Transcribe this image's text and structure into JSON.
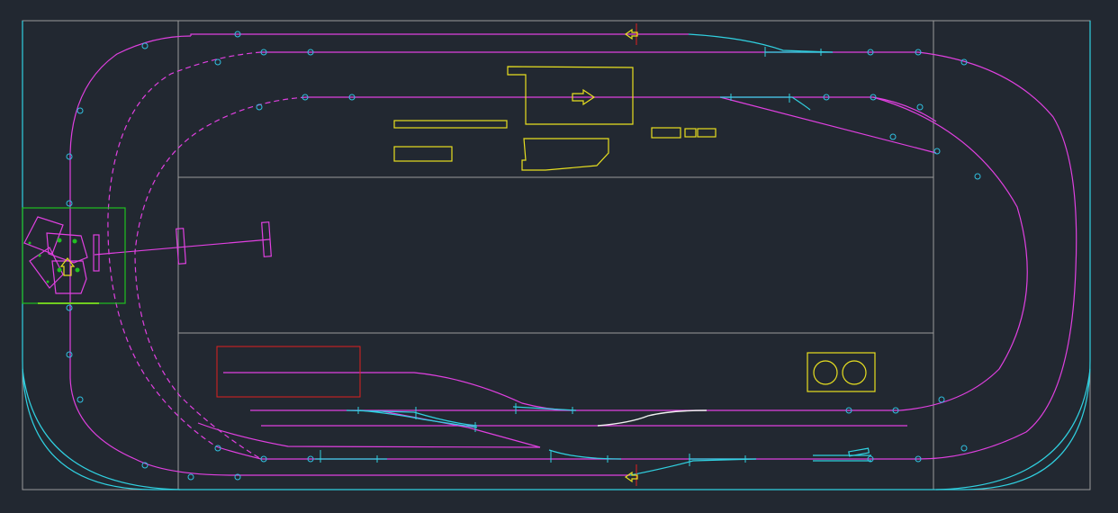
{
  "drawing": {
    "type": "model-railway-track-plan-cad",
    "background": "#222831",
    "colors": {
      "boundary": "#9a9a9a",
      "track": "#e040e0",
      "turnout": "#30d0e0",
      "structure": "#e8e020",
      "turntable_area": "#20c020",
      "red_marker": "#e02020",
      "white_curve": "#f0f0f0",
      "node_marker": "#30c0e0"
    }
  }
}
